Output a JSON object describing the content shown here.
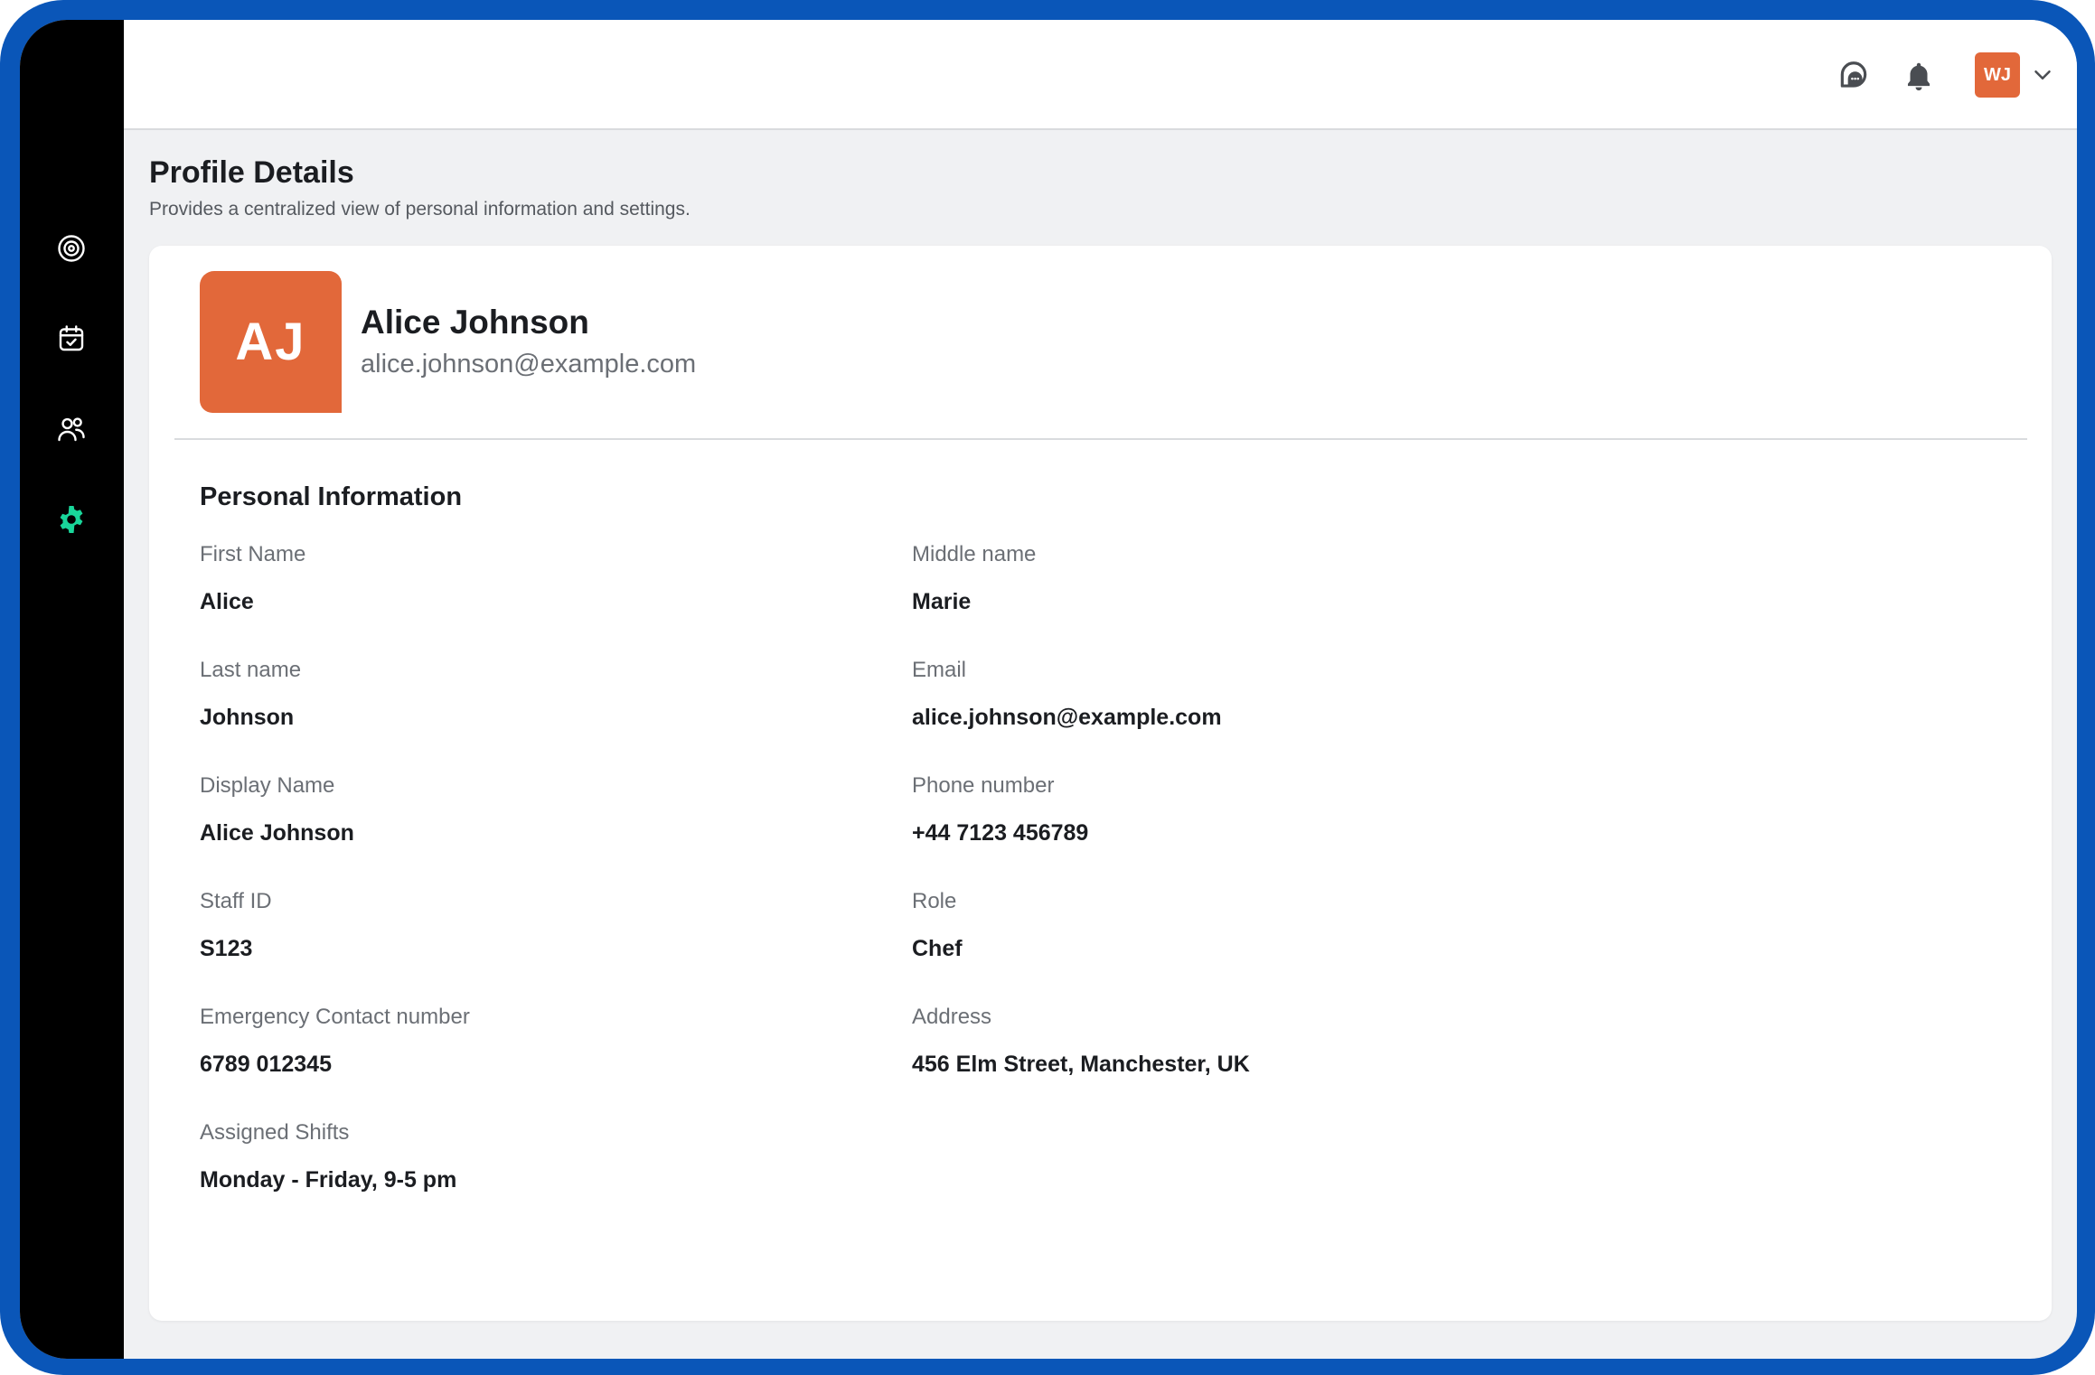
{
  "sidebar": {
    "items": [
      {
        "name": "dashboard",
        "icon": "target-gear-icon",
        "active": false
      },
      {
        "name": "calendar",
        "icon": "calendar-check-icon",
        "active": false
      },
      {
        "name": "team",
        "icon": "users-icon",
        "active": false
      },
      {
        "name": "settings",
        "icon": "gear-icon",
        "active": true
      }
    ],
    "active_color": "#19d69a"
  },
  "header": {
    "chat_icon": "chat-bubble-icon",
    "bell_icon": "bell-icon",
    "user_initials": "WJ",
    "dropdown_icon": "chevron-down-icon"
  },
  "page": {
    "title": "Profile Details",
    "subtitle": "Provides a centralized view of personal information and settings."
  },
  "profile": {
    "initials": "AJ",
    "name": "Alice Johnson",
    "email": "alice.johnson@example.com",
    "avatar_color": "#e2683a"
  },
  "personal_info": {
    "title": "Personal Information",
    "fields": [
      {
        "label": "First Name",
        "value": "Alice"
      },
      {
        "label": "Middle name",
        "value": "Marie"
      },
      {
        "label": "Last name",
        "value": "Johnson"
      },
      {
        "label": "Email",
        "value": "alice.johnson@example.com"
      },
      {
        "label": "Display Name",
        "value": "Alice Johnson"
      },
      {
        "label": "Phone number",
        "value": "+44 7123 456789"
      },
      {
        "label": "Staff ID",
        "value": "S123"
      },
      {
        "label": "Role",
        "value": "Chef"
      },
      {
        "label": "Emergency Contact number",
        "value": "6789 012345"
      },
      {
        "label": "Address",
        "value": "456 Elm Street, Manchester, UK"
      },
      {
        "label": "Assigned Shifts",
        "value": "Monday - Friday, 9-5 pm"
      }
    ]
  }
}
